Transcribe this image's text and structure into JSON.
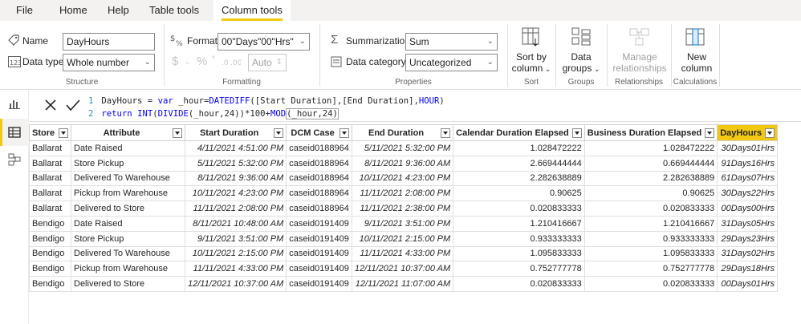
{
  "menu": {
    "tabs": [
      {
        "label": "File"
      },
      {
        "label": "Home"
      },
      {
        "label": "Help"
      },
      {
        "label": "Table tools"
      },
      {
        "label": "Column tools"
      }
    ]
  },
  "ribbon": {
    "structure": {
      "name_label": "Name",
      "name_value": "DayHours",
      "datatype_label": "Data type",
      "datatype_value": "Whole number",
      "group_label": "Structure"
    },
    "formatting": {
      "format_label": "Format",
      "format_value": "00\"Days\"00\"Hrs\"",
      "auto_value": "Auto",
      "group_label": "Formatting"
    },
    "properties": {
      "summarization_label": "Summarization",
      "summarization_value": "Sum",
      "category_label": "Data category",
      "category_value": "Uncategorized",
      "group_label": "Properties"
    },
    "sort": {
      "line1": "Sort by",
      "line2": "column",
      "group_label": "Sort"
    },
    "groups": {
      "line1": "Data",
      "line2": "groups",
      "group_label": "Groups"
    },
    "relationships": {
      "line1": "Manage",
      "line2": "relationships",
      "group_label": "Relationships"
    },
    "calculations": {
      "line1": "New",
      "line2": "column",
      "group_label": "Calculations"
    }
  },
  "formula": {
    "line1_num": "1",
    "line2_num": "2",
    "l1_a": "DayHours = ",
    "l1_var": "var",
    "l1_b": " _hour=",
    "l1_fn": "DATEDIFF",
    "l1_c": "([Start Duration],[End Duration],",
    "l1_hour": "HOUR",
    "l1_d": ")",
    "l2_return": "return",
    "l2_int": "INT",
    "l2_a": "(",
    "l2_divide": "DIVIDE",
    "l2_b": "(_hour,24))*100+",
    "l2_mod": "MOD",
    "l2_c": "(_hour,24)"
  },
  "table": {
    "columns": [
      "Store",
      "Attribute",
      "Start Duration",
      "DCM Case",
      "End Duration",
      "Calendar Duration Elapsed",
      "Business Duration Elapsed",
      "DayHours"
    ],
    "rows": [
      [
        "Ballarat",
        "Date Raised",
        "4/11/2021 4:51:00 PM",
        "caseid0188964",
        "5/11/2021 5:32:00 PM",
        "1.028472222",
        "1.028472222",
        "30Days01Hrs"
      ],
      [
        "Ballarat",
        "Store Pickup",
        "5/11/2021 5:32:00 PM",
        "caseid0188964",
        "8/11/2021 9:36:00 AM",
        "2.669444444",
        "0.669444444",
        "91Days16Hrs"
      ],
      [
        "Ballarat",
        "Delivered To Warehouse",
        "8/11/2021 9:36:00 AM",
        "caseid0188964",
        "10/11/2021 4:23:00 PM",
        "2.282638889",
        "2.282638889",
        "61Days07Hrs"
      ],
      [
        "Ballarat",
        "Pickup from Warehouse",
        "10/11/2021 4:23:00 PM",
        "caseid0188964",
        "11/11/2021 2:08:00 PM",
        "0.90625",
        "0.90625",
        "30Days22Hrs"
      ],
      [
        "Ballarat",
        "Delivered to Store",
        "11/11/2021 2:08:00 PM",
        "caseid0188964",
        "11/11/2021 2:38:00 PM",
        "0.020833333",
        "0.020833333",
        "00Days00Hrs"
      ],
      [
        "Bendigo",
        "Date Raised",
        "8/11/2021 10:48:00 AM",
        "caseid0191409",
        "9/11/2021 3:51:00 PM",
        "1.210416667",
        "1.210416667",
        "31Days05Hrs"
      ],
      [
        "Bendigo",
        "Store Pickup",
        "9/11/2021 3:51:00 PM",
        "caseid0191409",
        "10/11/2021 2:15:00 PM",
        "0.933333333",
        "0.933333333",
        "29Days23Hrs"
      ],
      [
        "Bendigo",
        "Delivered To Warehouse",
        "10/11/2021 2:15:00 PM",
        "caseid0191409",
        "11/11/2021 4:33:00 PM",
        "1.095833333",
        "1.095833333",
        "31Days02Hrs"
      ],
      [
        "Bendigo",
        "Pickup from Warehouse",
        "11/11/2021 4:33:00 PM",
        "caseid0191409",
        "12/11/2021 10:37:00 AM",
        "0.752777778",
        "0.752777778",
        "29Days18Hrs"
      ],
      [
        "Bendigo",
        "Delivered to Store",
        "12/11/2021 10:37:00 AM",
        "caseid0191409",
        "12/11/2021 11:07:00 AM",
        "0.020833333",
        "0.020833333",
        "00Days01Hrs"
      ]
    ]
  },
  "colors": {
    "accent": "#f2c811",
    "formula_keyword": "#0000ff",
    "line_number": "#2b91af"
  },
  "icons": {
    "name": "tag-icon",
    "datatype": "datatype-123-icon",
    "format": "dollar-percent-format-icon",
    "summarization": "sigma-icon",
    "category": "data-category-icon",
    "sort": "sort-by-column-icon",
    "groups": "data-groups-icon",
    "relationships": "manage-relationships-icon",
    "newcolumn": "new-column-icon",
    "report": "report-view-icon",
    "data": "data-view-icon",
    "model": "model-view-icon"
  }
}
